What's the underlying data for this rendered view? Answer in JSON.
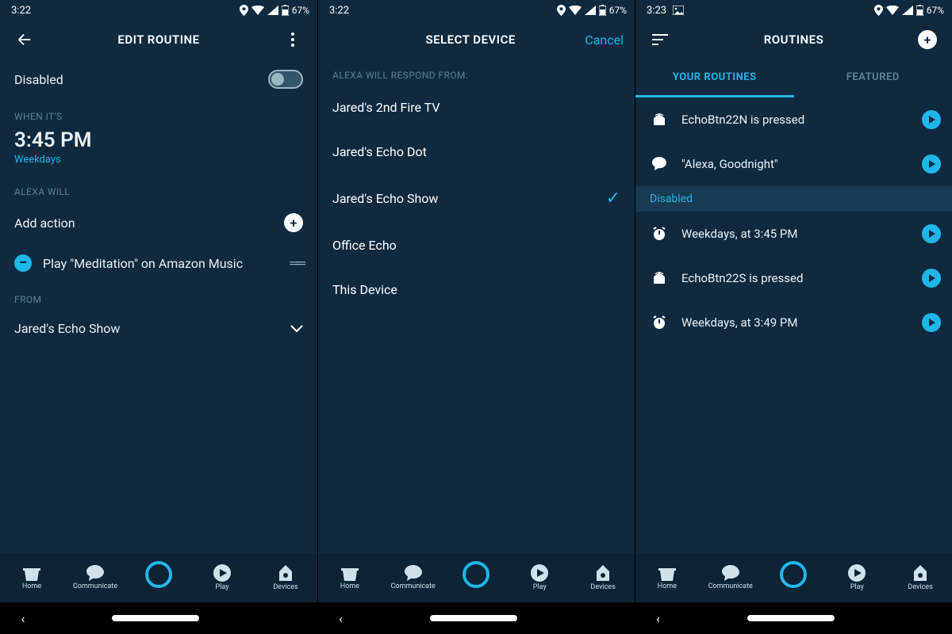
{
  "statusbar": {
    "time_a": "3:22",
    "time_c": "3:23",
    "battery": "67%"
  },
  "screen1": {
    "title": "EDIT ROUTINE",
    "disabled_label": "Disabled",
    "when_label": "WHEN IT'S",
    "when_time": "3:45 PM",
    "when_days": "Weekdays",
    "will_label": "ALEXA WILL",
    "add_action": "Add action",
    "action_text": "Play \"Meditation\" on Amazon Music",
    "from_label": "FROM",
    "from_device": "Jared's Echo Show"
  },
  "screen2": {
    "title": "SELECT DEVICE",
    "cancel": "Cancel",
    "respond_label": "ALEXA WILL RESPOND FROM:",
    "devices": [
      {
        "name": "Jared's 2nd Fire TV",
        "selected": false
      },
      {
        "name": "Jared's Echo Dot",
        "selected": false
      },
      {
        "name": "Jared's Echo Show",
        "selected": true
      },
      {
        "name": "Office Echo",
        "selected": false
      },
      {
        "name": "This Device",
        "selected": false
      }
    ]
  },
  "screen3": {
    "title": "ROUTINES",
    "tabs": {
      "your": "YOUR ROUTINES",
      "featured": "FEATURED"
    },
    "disabled_header": "Disabled",
    "routines_enabled": [
      {
        "icon": "echo-button",
        "label": "EchoBtn22N is pressed"
      },
      {
        "icon": "speech",
        "label": "\"Alexa, Goodnight\""
      }
    ],
    "routines_disabled": [
      {
        "icon": "alarm",
        "label": "Weekdays, at 3:45 PM"
      },
      {
        "icon": "echo-button",
        "label": "EchoBtn22S is pressed"
      },
      {
        "icon": "alarm",
        "label": "Weekdays, at 3:49 PM"
      }
    ]
  },
  "nav": {
    "home": "Home",
    "communicate": "Communicate",
    "play": "Play",
    "devices": "Devices"
  }
}
